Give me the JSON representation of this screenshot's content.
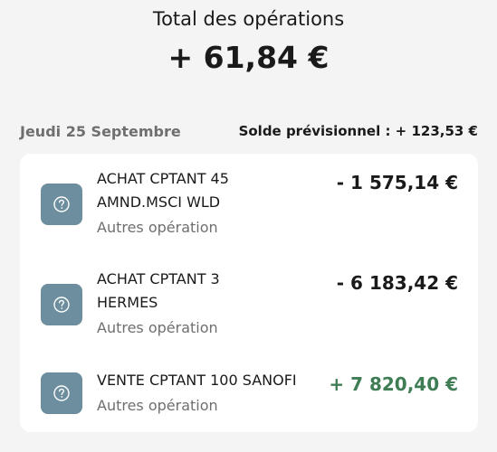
{
  "summary": {
    "title": "Total des opérations",
    "total": "+ 61,84 €"
  },
  "day": {
    "label": "Jeudi 25 Septembre",
    "balance": "Solde prévisionnel : + 123,53 €"
  },
  "operations": [
    {
      "name": " ACHAT CPTANT 45\nAMND.MSCI WLD",
      "category": "Autres opération",
      "amount": "- 1 575,14 €",
      "icon": "question-icon",
      "sign": "negative"
    },
    {
      "name": " ACHAT CPTANT 3\nHERMES",
      "category": "Autres opération",
      "amount": "- 6 183,42 €",
      "icon": "question-icon",
      "sign": "negative"
    },
    {
      "name": " VENTE CPTANT 100 SANOFI",
      "category": "Autres opération",
      "amount": "+ 7 820,40 €",
      "icon": "question-icon",
      "sign": "positive"
    }
  ],
  "colors": {
    "background": "#f4f4f4",
    "card": "#ffffff",
    "icon_bg": "#6d8e9e",
    "positive": "#3f7d55",
    "muted": "#6f6f6f"
  }
}
